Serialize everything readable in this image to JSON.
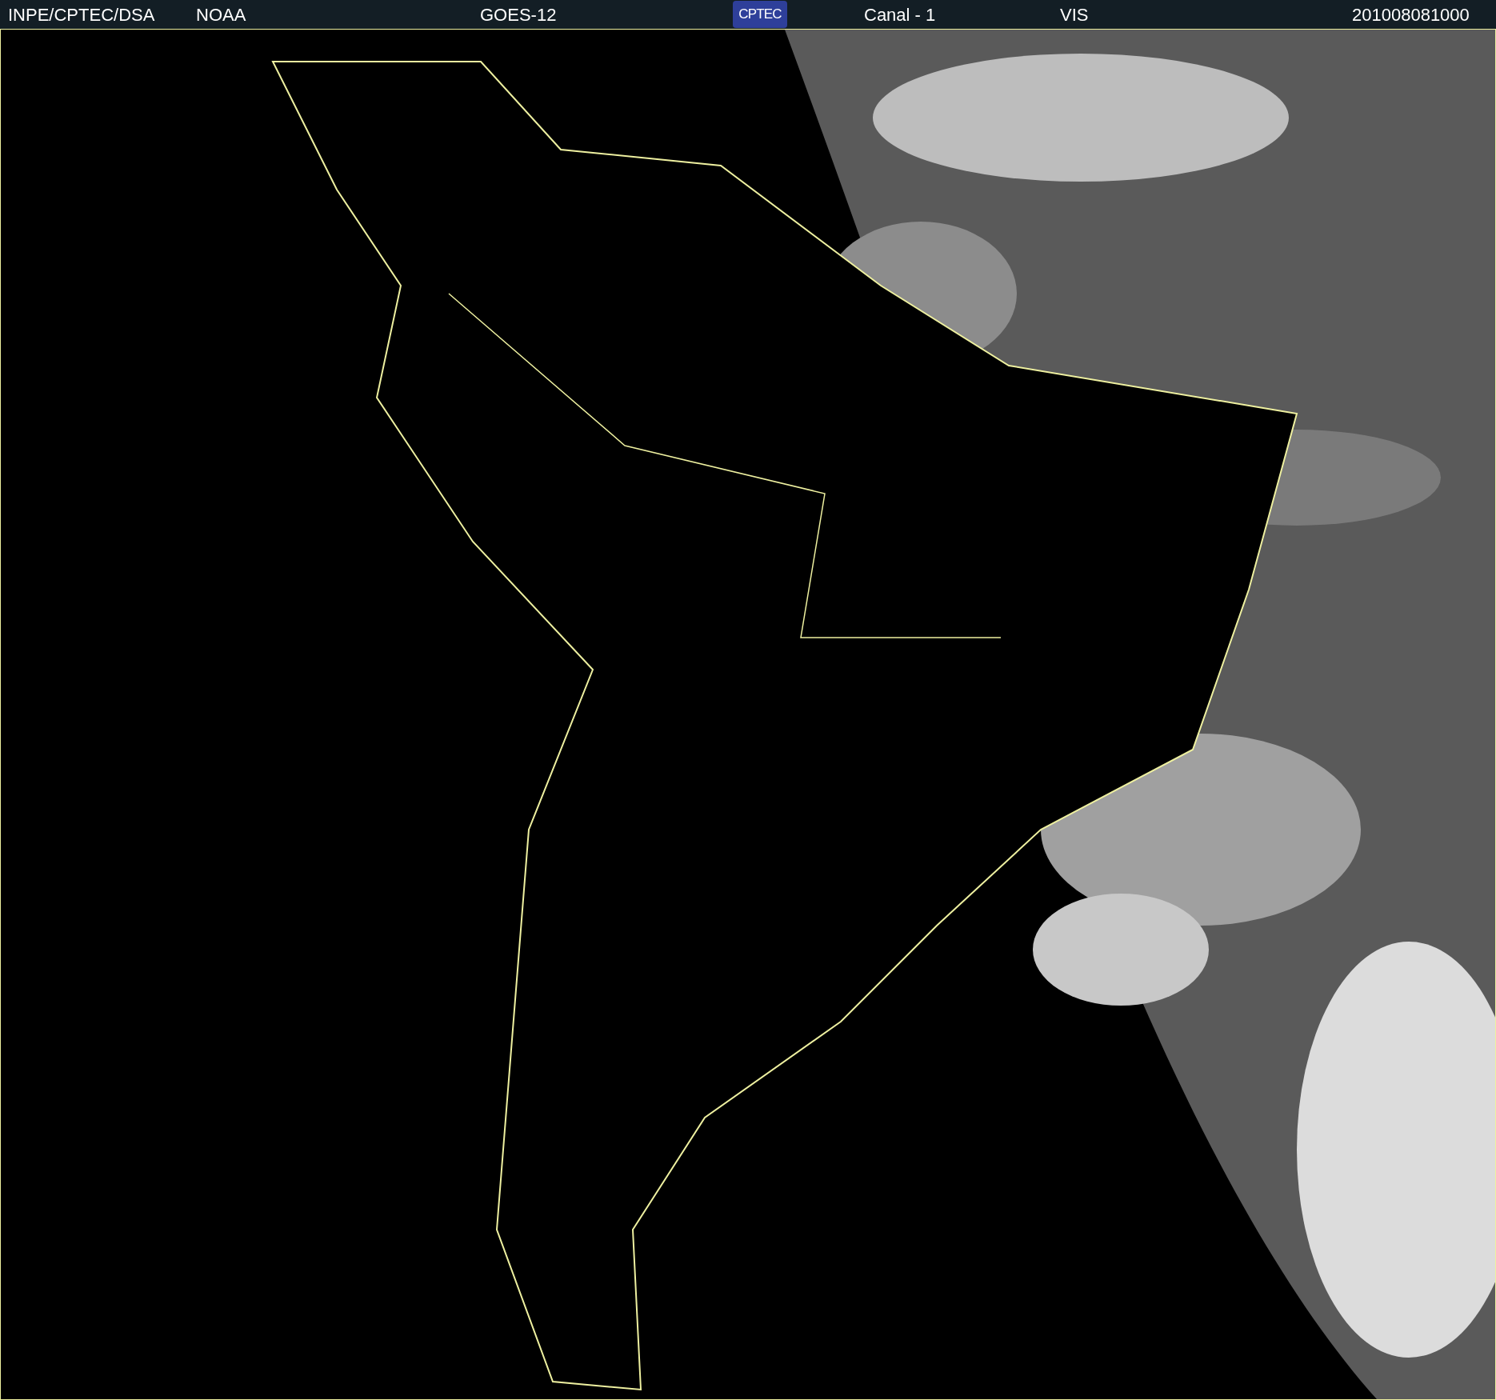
{
  "header": {
    "source": "INPE/CPTEC/DSA",
    "agency": "NOAA",
    "satellite": "GOES-12",
    "logo": "CPTEC",
    "channel": "Canal - 1",
    "band": "VIS",
    "timestamp": "201008081000"
  }
}
